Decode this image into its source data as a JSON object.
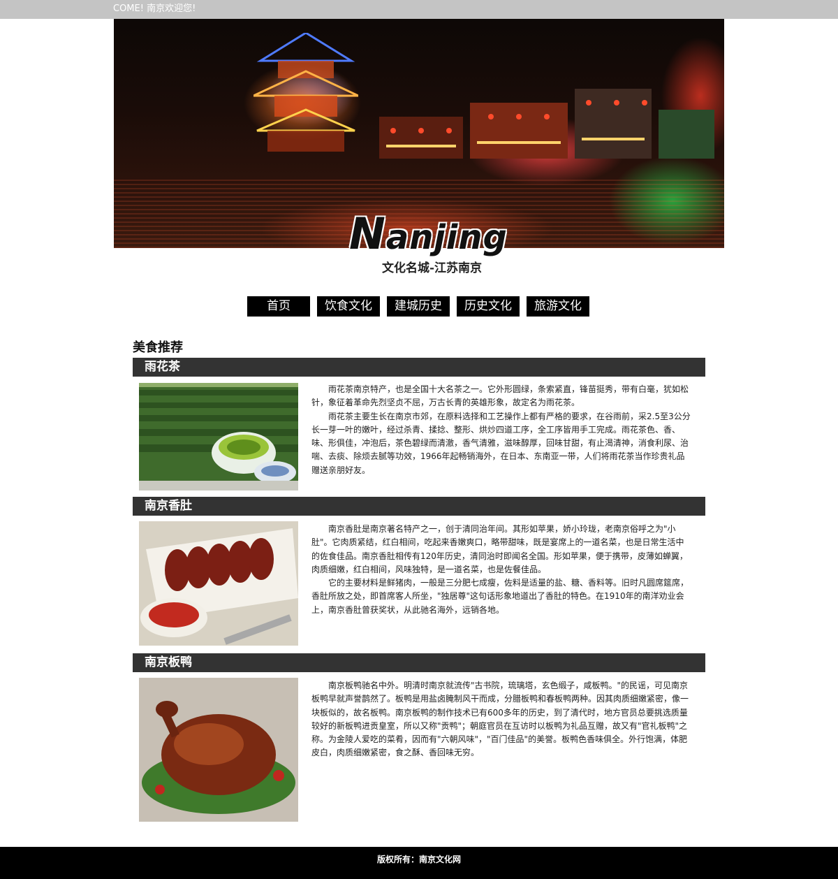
{
  "topbar": {
    "welcome": "COME! 南京欢迎您!"
  },
  "logo": {
    "cap": "N",
    "rest": "anjing",
    "subtitle": "文化名城-江苏南京"
  },
  "nav": {
    "items": [
      {
        "label": "首页"
      },
      {
        "label": "饮食文化"
      },
      {
        "label": "建城历史"
      },
      {
        "label": "历史文化"
      },
      {
        "label": "旅游文化"
      }
    ]
  },
  "main": {
    "section_title": "美食推荐",
    "foods": [
      {
        "name": "雨花茶",
        "paragraphs": [
          "雨花茶南京特产，也是全国十大名茶之一。它外形圆绿，条索紧直，锋苗挺秀，带有白毫，犹如松针，象征着革命先烈坚贞不屈，万古长青的英雄形象，故定名为雨花茶。",
          "雨花茶主要生长在南京市郊，在原料选择和工艺操作上都有严格的要求，在谷雨前，采2.5至3公分长一芽一叶的嫩叶，经过杀青、揉捻、整形、烘炒四道工序，全工序皆用手工完成。雨花茶色、香、味、形俱佳，冲泡后，茶色碧绿而清澈，香气清雅，滋味醇厚，回味甘甜，有止渴清神，消食利尿、治喘、去痰、除烦去腻等功效，1966年起畅销海外，在日本、东南亚一带，人们将雨花茶当作珍贵礼品赠送亲朋好友。"
        ]
      },
      {
        "name": "南京香肚",
        "paragraphs": [
          "南京香肚是南京著名特产之一，创于清同治年间。其形如苹果，娇小玲珑，老南京俗呼之为\"小肚\"。它肉质紧结，红白相间，吃起来香嫩爽口，略带甜味，既是宴席上的一道名菜，也是日常生活中的佐食佳品。南京香肚相传有120年历史，清同治时即闻名全国。形如苹果，便于携带，皮薄如蝉翼，肉质细嫩，红白相间，风味独特，是一道名菜，也是佐餐佳品。",
          "它的主要材料是鲜猪肉，一般是三分肥七成瘦，佐料是适量的盐、糖、香料等。旧时凡圆席筵席，香肚所放之处，即首席客人所坐，\"独居尊\"这句话形象地道出了香肚的特色。在1910年的南洋劝业会上，南京香肚曾获奖状，从此驰名海外，远销各地。"
        ]
      },
      {
        "name": "南京板鸭",
        "paragraphs": [
          "南京板鸭驰名中外。明清时南京就流传\"古书院，琉璃塔，玄色缎子，咸板鸭。\"的民谣，可见南京板鸭早就声誉鹊然了。板鸭是用盐卤腌制风干而成，分腊板鸭和春板鸭两种。因其肉质细嫩紧密，像一块板似的，故名板鸭。南京板鸭的制作技术已有600多年的历史，到了清代时，地方官员总要挑选质量较好的新板鸭进贡皇室，所以又称\"贡鸭\"；朝庭官员在互访时以板鸭为礼品互赠，故又有\"官礼板鸭\"之称。为金陵人爱吃的菜肴，因而有\"六朝风味\"，\"百门佳品\"的美誉。板鸭色香味俱全。外行饱满，体肥皮白，肉质细嫩紧密，食之酥、香回味无穷。"
        ]
      }
    ]
  },
  "footer": {
    "copyright": "版权所有：南京文化网"
  }
}
